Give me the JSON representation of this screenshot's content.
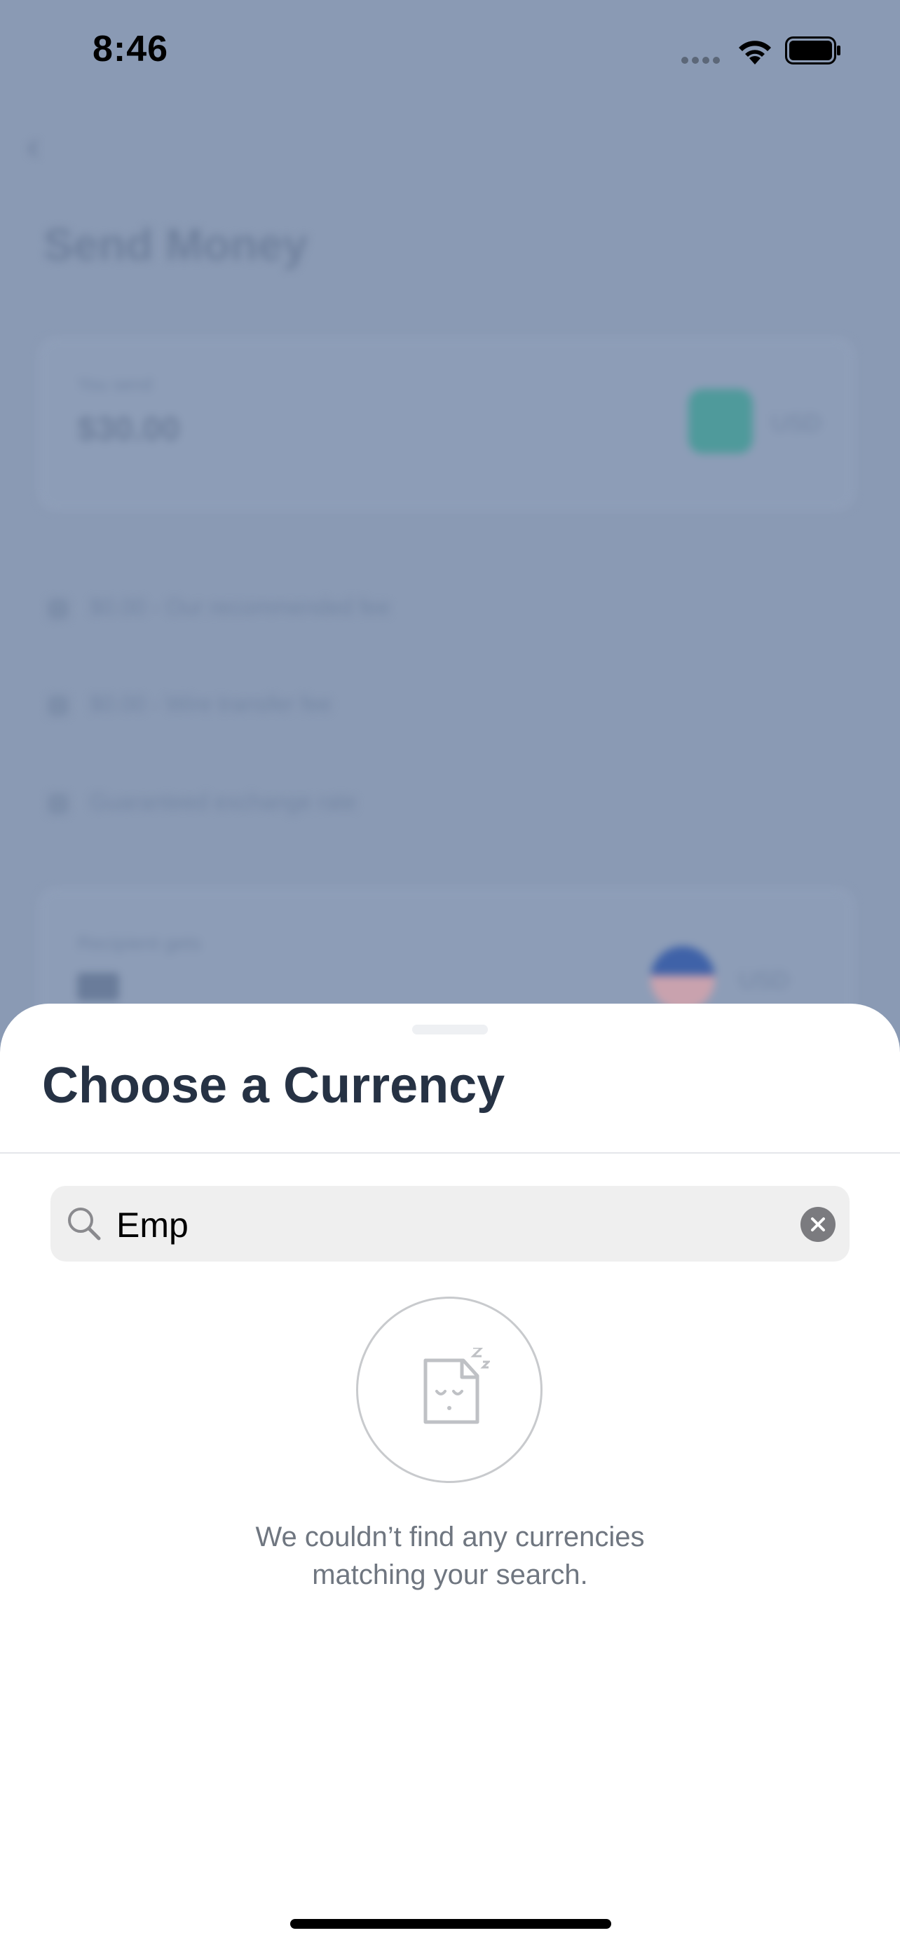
{
  "status_bar": {
    "time": "8:46"
  },
  "background": {
    "title": "Send Money",
    "you_send_label": "You send",
    "you_send_amount": "$30.00",
    "you_send_currency": "USD",
    "rows": [
      "$0.00 - Our recommended fee",
      "$0.00 - Wire transfer fee",
      "Guaranteed exchange rate"
    ],
    "recipient_label": "Recipient gets",
    "recipient_currency": "USD"
  },
  "sheet": {
    "title": "Choose a Currency",
    "search": {
      "value": "Emp",
      "placeholder": "Search"
    },
    "empty_state": {
      "line1": "We couldn’t find any currencies",
      "line2": "matching your search."
    }
  },
  "colors": {
    "title": "#263244",
    "overlay": "#8093af",
    "search_bg": "#efefef",
    "empty_text": "#6f7680"
  },
  "icons": [
    "back-chevron-icon",
    "wifi-icon",
    "battery-icon",
    "search-icon",
    "clear-icon",
    "sleeping-document-icon"
  ]
}
